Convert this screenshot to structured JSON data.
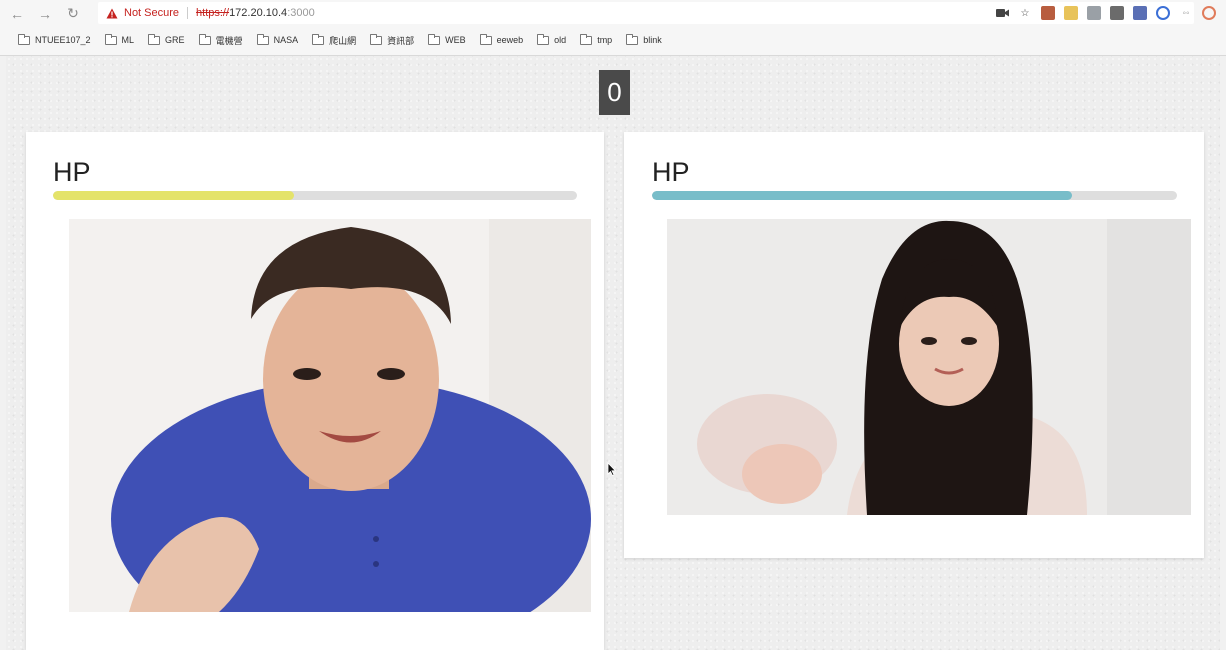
{
  "browser": {
    "security_label": "Not Secure",
    "url_scheme": "https://",
    "url_host": "172.20.10.4",
    "url_port": ":3000",
    "icons": [
      "back-icon",
      "forward-icon",
      "reload-icon",
      "warning-icon"
    ],
    "extensions": [
      "camera-icon",
      "star-icon",
      "extension-icon",
      "extension-icon",
      "extension-icon",
      "extension-icon",
      "extension-icon",
      "extension-icon",
      "extension-icon",
      "profile-icon"
    ]
  },
  "bookmarks": [
    "NTUEE107_2",
    "ML",
    "GRE",
    "電機營",
    "NASA",
    "爬山網",
    "資訊部",
    "WEB",
    "eeweb",
    "old",
    "tmp",
    "blink"
  ],
  "game": {
    "counter": "0",
    "player_left": {
      "hp_label": "HP",
      "hp_fraction": 0.46,
      "hp_color": "#e4e36a"
    },
    "player_right": {
      "hp_label": "HP",
      "hp_fraction": 0.8,
      "hp_color": "#78bdc9"
    }
  },
  "colors": {
    "not_secure": "#c5221f",
    "counter_bg": "#4a4a4a"
  }
}
